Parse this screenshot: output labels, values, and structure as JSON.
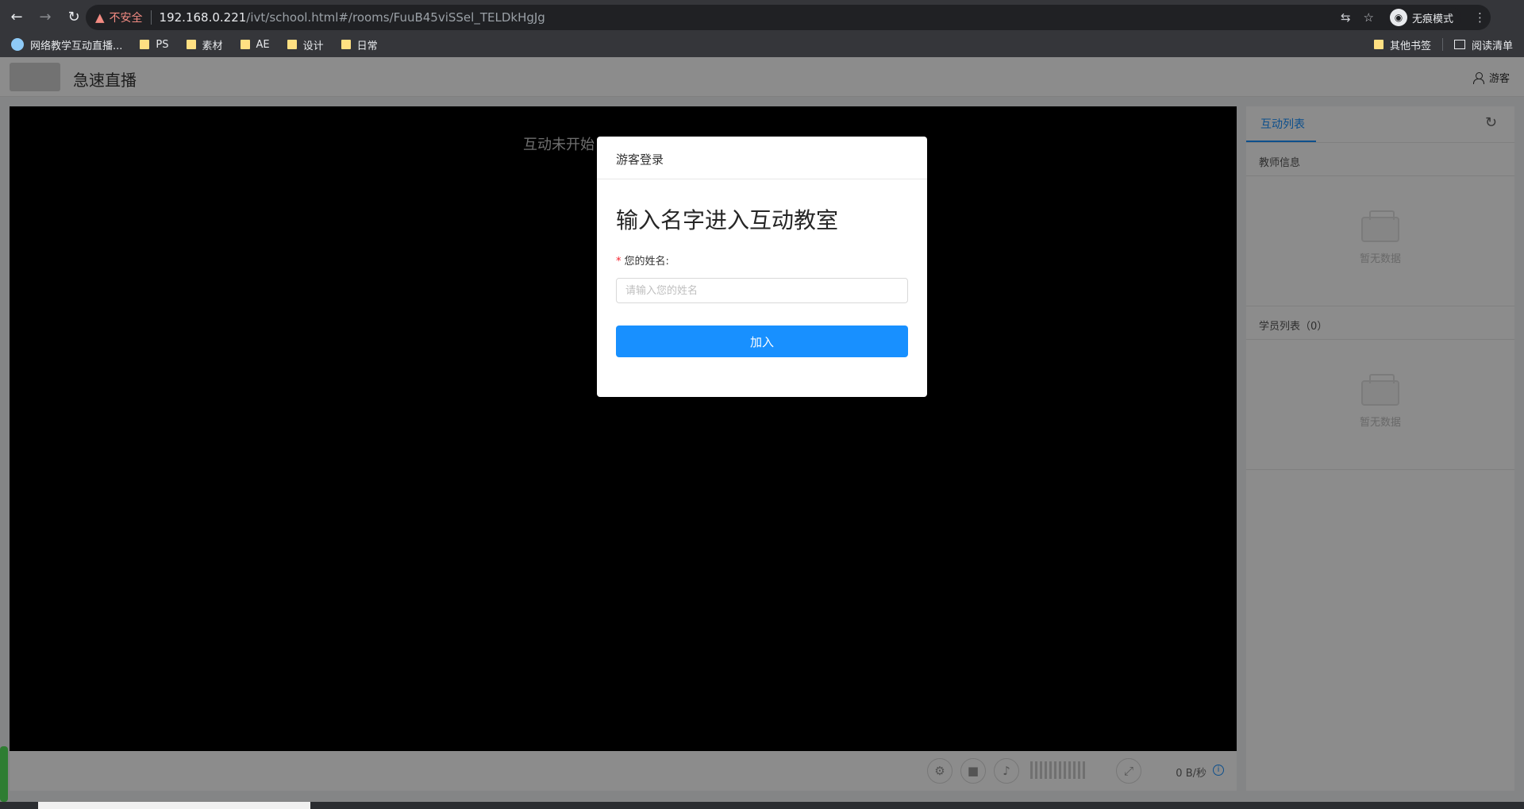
{
  "browser": {
    "security_label": "不安全",
    "url_host": "192.168.0.221",
    "url_path": "/ivt/school.html#/rooms/FuuB45viSSel_TELDkHgJg",
    "incognito_label": "无痕模式",
    "bookmarks": [
      "网络教学互动直播...",
      "PS",
      "素材",
      "AE",
      "设计",
      "日常"
    ],
    "other_bookmarks": "其他书签",
    "reading_list": "阅读清单"
  },
  "app": {
    "title": "急速直播",
    "user_label": "游客"
  },
  "video": {
    "status_message": "互动未开始",
    "bitrate": "0 B/秒"
  },
  "sidebar": {
    "tab_label": "互动列表",
    "teacher_section": "教师信息",
    "student_section": "学员列表（0）",
    "empty_text": "暂无数据"
  },
  "modal": {
    "title": "游客登录",
    "heading": "输入名字进入互动教室",
    "field_label": "您的姓名:",
    "placeholder": "请输入您的姓名",
    "submit_label": "加入"
  },
  "icons": {
    "back": "arrow-left",
    "forward": "arrow-right",
    "reload": "refresh",
    "warning": "warning-triangle",
    "translate": "translate",
    "star": "star",
    "menu": "more-vertical",
    "settings": "gear",
    "camera": "camera",
    "mic": "microphone",
    "fullscreen": "expand",
    "info": "info-circle"
  }
}
